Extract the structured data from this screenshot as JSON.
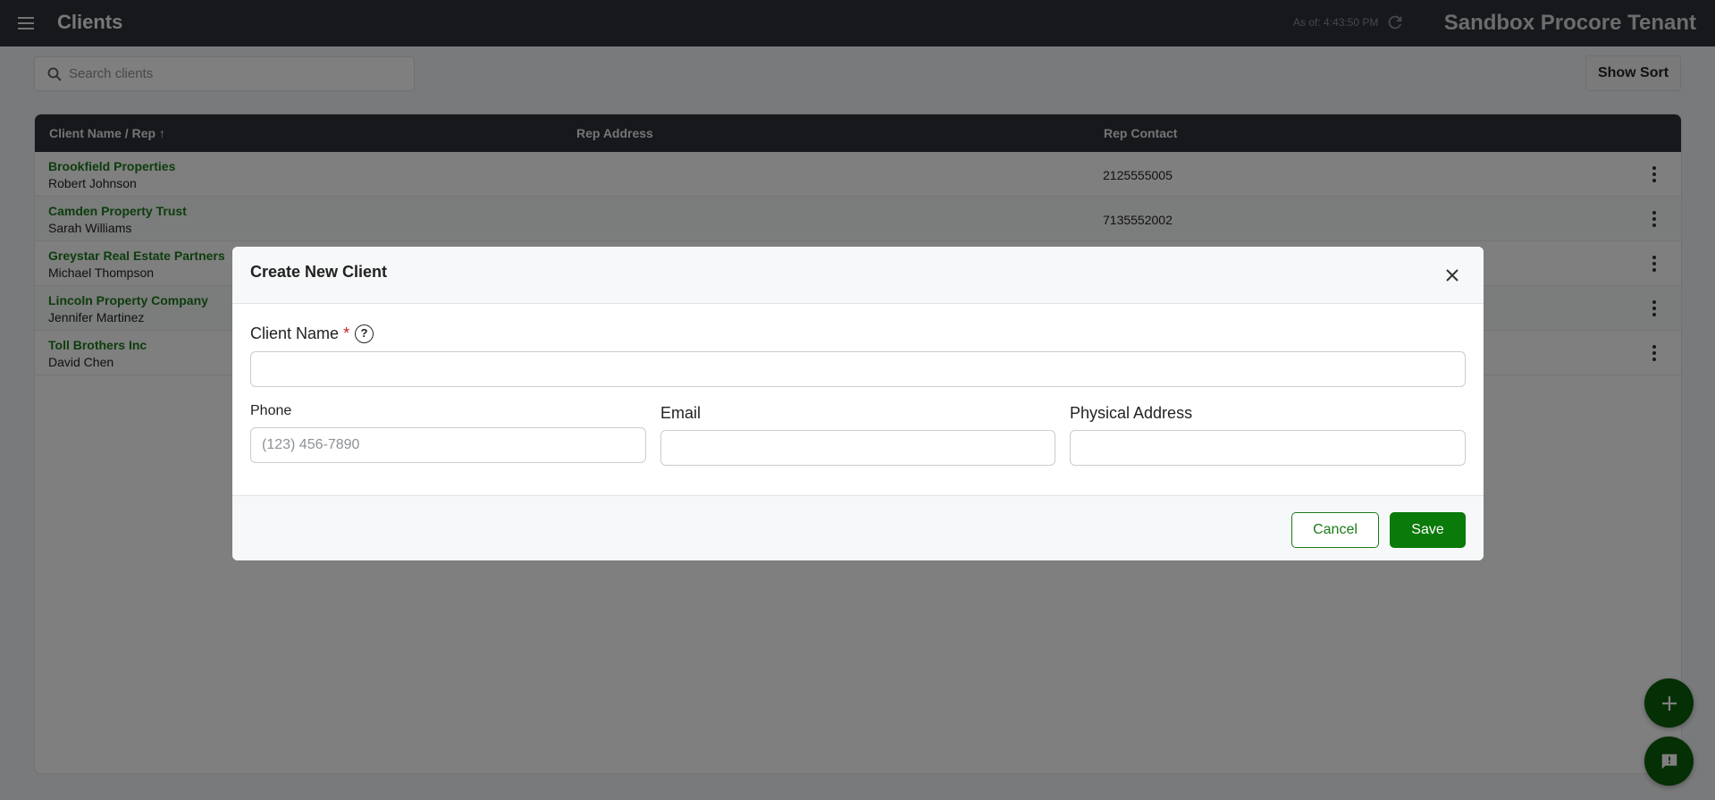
{
  "header": {
    "title": "Clients",
    "as_of": "As of: 4:43:50 PM",
    "tenant": "Sandbox Procore Tenant"
  },
  "toolbar": {
    "search_placeholder": "Search clients",
    "show_sort_label": "Show Sort"
  },
  "table": {
    "columns": [
      "Client Name / Rep ↑",
      "Rep Address",
      "Rep Contact"
    ],
    "rows": [
      {
        "client": "Brookfield Properties",
        "rep": "Robert Johnson",
        "address": "",
        "contact": "2125555005"
      },
      {
        "client": "Camden Property Trust",
        "rep": "Sarah Williams",
        "address": "",
        "contact": "7135552002"
      },
      {
        "client": "Greystar Real Estate Partners",
        "rep": "Michael Thompson",
        "address": "",
        "contact": ""
      },
      {
        "client": "Lincoln Property Company",
        "rep": "Jennifer Martinez",
        "address": "",
        "contact": ""
      },
      {
        "client": "Toll Brothers Inc",
        "rep": "David Chen",
        "address": "",
        "contact": ""
      }
    ]
  },
  "modal": {
    "title": "Create New Client",
    "client_name_label": "Client Name",
    "required_mark": "*",
    "help_glyph": "?",
    "client_name_value": "",
    "phone_label": "Phone",
    "phone_placeholder": "(123) 456-7890",
    "email_label": "Email",
    "address_label": "Physical Address",
    "cancel_label": "Cancel",
    "save_label": "Save"
  },
  "colors": {
    "brand_green": "#0a7a0a",
    "link_green": "#1a7a1a",
    "header_bg": "#2d3138"
  }
}
